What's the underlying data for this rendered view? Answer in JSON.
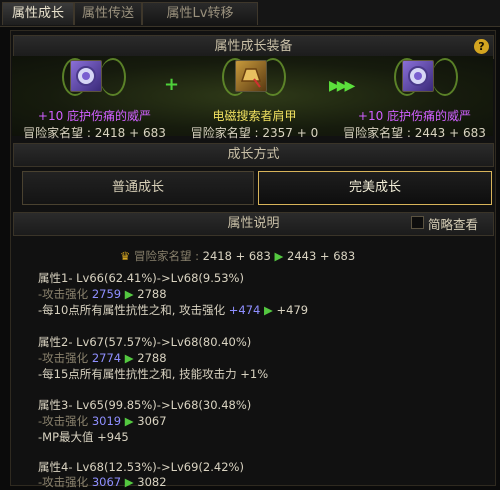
{
  "tabs": [
    {
      "label": "属性成长"
    },
    {
      "label": "属性传送"
    },
    {
      "label": "属性Lv转移"
    }
  ],
  "equip_section": {
    "title": "属性成长装备",
    "source": {
      "line1": "+10 庇护伤痛的威严",
      "line2": "冒险家名望 : 2418 + 683"
    },
    "material": {
      "line1": "电磁搜索者肩甲",
      "line2": "冒险家名望 : 2357 + 0"
    },
    "result": {
      "line1": "+10 庇护伤痛的威严",
      "line2": "冒险家名望 : 2443 + 683"
    }
  },
  "growth_section": {
    "title": "成长方式",
    "normal_label": "普通成长",
    "perfect_label": "完美成长"
  },
  "desc_section": {
    "title": "属性说明",
    "brief_label": "简略查看"
  },
  "fame": {
    "label": "冒险家名望 :",
    "current": "2418 + 683",
    "next": "2443 + 683"
  },
  "attributes": [
    {
      "title": "属性1- Lv66(62.41%)->Lv68(9.53%)",
      "stat_label": "-攻击强化",
      "stat_from": "2759",
      "stat_to": "2788",
      "effect_text": "-每10点所有属性抗性之和, 攻击强化",
      "effect_from": "+474",
      "effect_to": "+479"
    },
    {
      "title": "属性2- Lv67(57.57%)->Lv68(80.40%)",
      "stat_label": "-攻击强化",
      "stat_from": "2774",
      "stat_to": "2788",
      "effect_text": "-每15点所有属性抗性之和, 技能攻击力 +1%"
    },
    {
      "title": "属性3- Lv65(99.85%)->Lv68(30.48%)",
      "stat_label": "-攻击强化",
      "stat_from": "3019",
      "stat_to": "3067",
      "effect_text": "-MP最大值 +945"
    },
    {
      "title": "属性4- Lv68(12.53%)->Lv69(2.42%)",
      "stat_label": "-攻击强化",
      "stat_from": "3067",
      "stat_to": "3082"
    }
  ],
  "icons": {
    "help": "?",
    "arrow": "▶",
    "plus": "+"
  }
}
